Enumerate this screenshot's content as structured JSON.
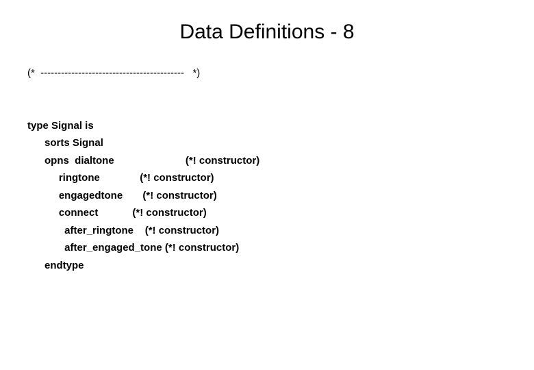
{
  "title": "Data Definitions - 8",
  "comment_line": "(*  ------------------------------------------   *)",
  "lines": {
    "l0": "type Signal is",
    "l1": "      sorts Signal",
    "l2_a": "      opns  dialtone",
    "l2_b": "(*! constructor)",
    "l3_a": "           ringtone",
    "l3_b": "(*! constructor)",
    "l4_a": "           engagedtone",
    "l4_b": "(*! constructor)",
    "l5_a": "           connect",
    "l5_b": "(*! constructor)",
    "l6_a": "             after_ringtone",
    "l6_b": "(*! constructor)",
    "l7_a": "             after_engaged_tone",
    "l7_b": "(*! constructor)",
    "l8": "      endtype"
  }
}
